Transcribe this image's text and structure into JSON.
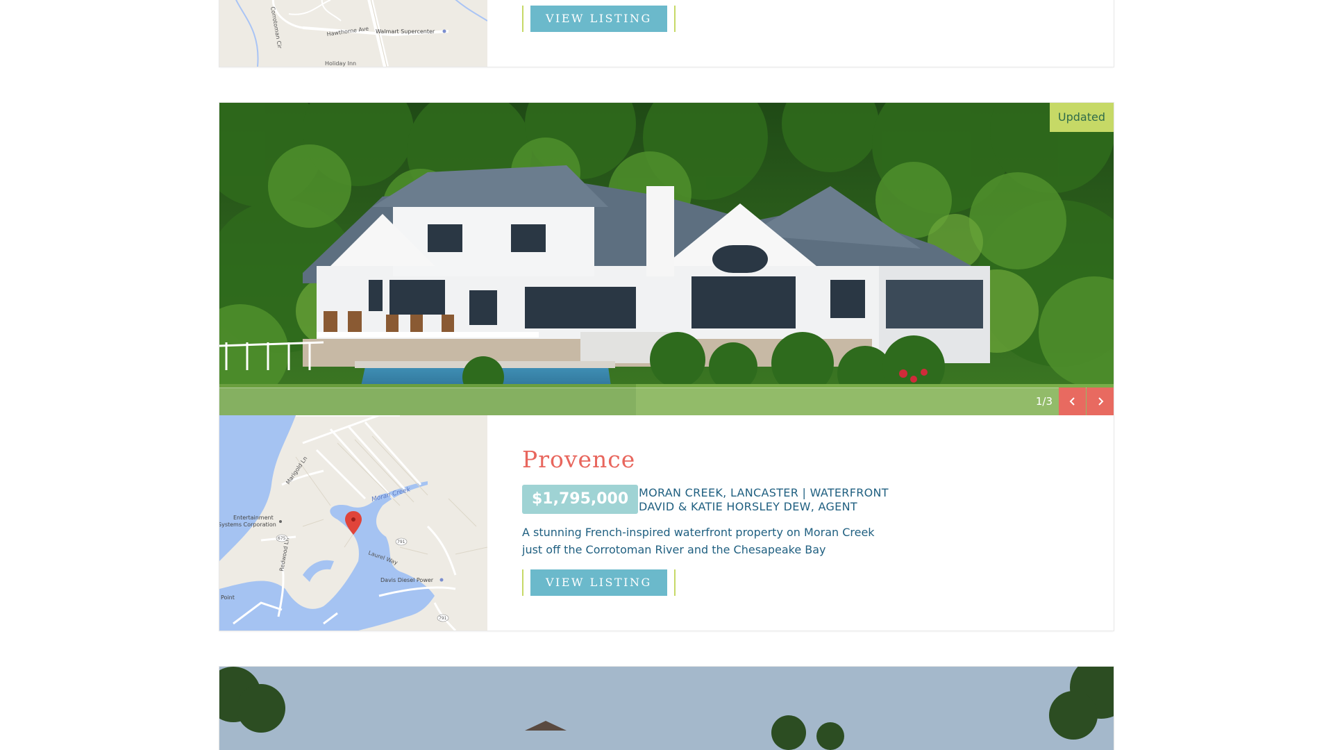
{
  "previous_listing": {
    "button_label": "VIEW LISTING",
    "map_labels": {
      "street1": "Corrotoman Cir",
      "street2": "Hawthorne Ave",
      "poi1": "Walmart Supercenter",
      "poi2": "Holiday Inn"
    }
  },
  "listing": {
    "badge": "Updated",
    "slide_counter": "1/3",
    "title": "Provence",
    "price": "$1,795,000",
    "location": "MORAN CREEK, LANCASTER | WATERFRONT",
    "agent": "DAVID & KATIE HORSLEY DEW, AGENT",
    "description": "A stunning French-inspired waterfront property on Moran Creek just off the Corrotoman River and the Chesapeake Bay",
    "button_label": "VIEW LISTING",
    "map_labels": {
      "street1": "Marigold Ln",
      "street2": "Moran Creek",
      "street3": "Redwood Ln",
      "street4": "Laurel Way",
      "poi1": "Entertainment",
      "poi1b": "Systems Corporation",
      "poi2": "Davis Diesel Power",
      "poi3": "Point",
      "route1": "675",
      "route2": "791",
      "route3": "791"
    }
  },
  "colors": {
    "title": "#e8665d",
    "price_bg": "#9fd3d4",
    "button_bg": "#6bb9cb",
    "button_frame": "#c6d966",
    "badge_bg": "#c6d966",
    "text": "#1f5f80",
    "arrow_bg": "#e86a60"
  },
  "icons": {
    "prev": "chevron-left-icon",
    "next": "chevron-right-icon",
    "map_pin": "map-pin-icon"
  }
}
